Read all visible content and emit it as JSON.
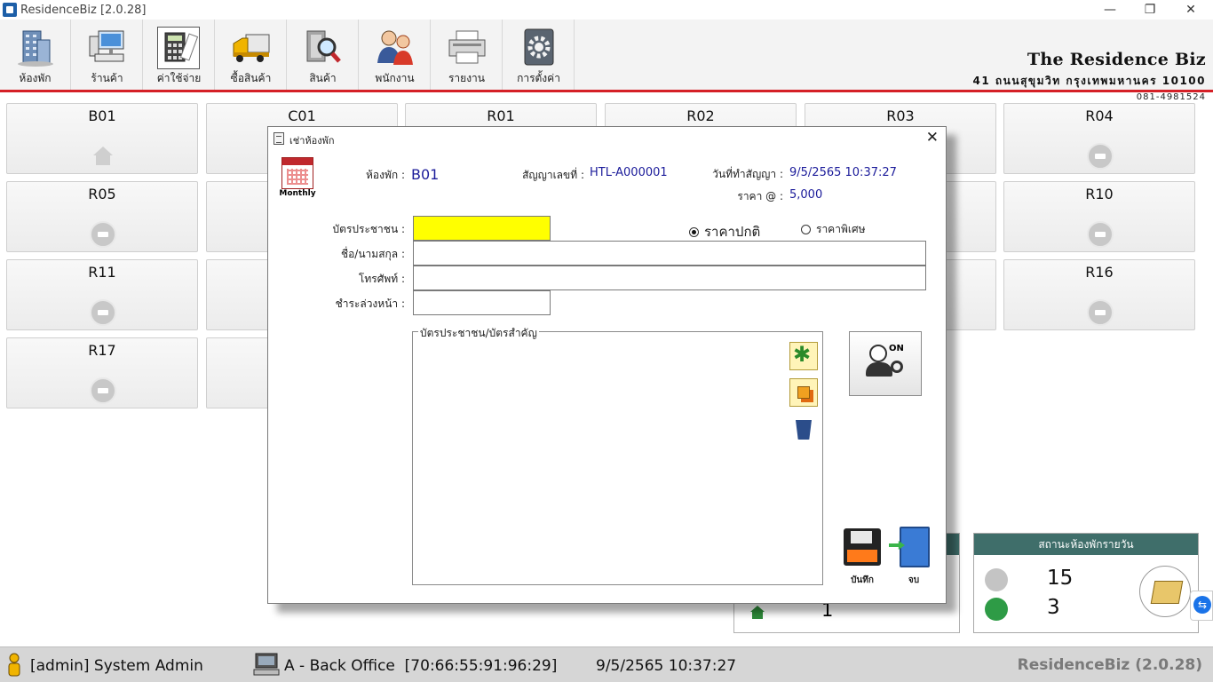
{
  "window": {
    "title": "ResidenceBiz [2.0.28]",
    "minimize": "—",
    "restore": "❐",
    "close": "✕"
  },
  "toolbar": {
    "items": [
      {
        "label": "ห้องพัก",
        "icon": "building-icon"
      },
      {
        "label": "ร้านค้า",
        "icon": "computer-icon"
      },
      {
        "label": "ค่าใช้จ่าย",
        "icon": "calculator-icon"
      },
      {
        "label": "ซื้อสินค้า",
        "icon": "truck-icon"
      },
      {
        "label": "สินค้า",
        "icon": "product-search-icon"
      },
      {
        "label": "พนักงาน",
        "icon": "staff-icon"
      },
      {
        "label": "รายงาน",
        "icon": "printer-icon"
      },
      {
        "label": "การตั้งค่า",
        "icon": "settings-gear-icon"
      }
    ]
  },
  "company": {
    "name": "The Residence Biz",
    "address": "41 ถนนสุขุมวิท กรุงเทพมหานคร 10100",
    "phone": "081-4981524"
  },
  "rooms": [
    {
      "name": "B01",
      "status": "home"
    },
    {
      "name": "C01",
      "status": "vacant"
    },
    {
      "name": "R01",
      "status": "vacant"
    },
    {
      "name": "R02",
      "status": "vacant"
    },
    {
      "name": "R03",
      "status": "vacant"
    },
    {
      "name": "R04",
      "status": "vacant"
    },
    {
      "name": "R05",
      "status": "vacant"
    },
    {
      "name": "R10",
      "status": "vacant"
    },
    {
      "name": "R11",
      "status": "vacant"
    },
    {
      "name": "R16",
      "status": "vacant"
    },
    {
      "name": "R17",
      "status": "vacant"
    }
  ],
  "daily_status": {
    "title": "สถานะห้องพักรายวัน",
    "vacant_count": "15",
    "occupied_count": "3",
    "other_count": "1"
  },
  "statusbar": {
    "user": "[admin] System Admin",
    "terminal": "A - Back Office  [70:66:55:91:96:29]",
    "datetime": "9/5/2565 10:37:27",
    "brand": "ResidenceBiz (2.0.28)"
  },
  "dialog": {
    "title": "เช่าห้องพัก",
    "close": "✕",
    "type_label": "Monthly",
    "room_label": "ห้องพัก :",
    "room_value": "B01",
    "contract_label": "สัญญาเลขที่ :",
    "contract_value": "HTL-A000001",
    "date_label": "วันที่ทำสัญญา :",
    "date_value": "9/5/2565 10:37:27",
    "price_label": "ราคา @ :",
    "price_value": "5,000",
    "id_card_label": "บัตรประชาชน :",
    "id_card_value": "",
    "name_label": "ชื่อ/นามสกุล :",
    "name_value": "",
    "phone_label": "โทรศัพท์ :",
    "phone_value": "",
    "deposit_label": "ชำระล่วงหน้า :",
    "deposit_value": "",
    "radio_normal": "ราคาปกติ",
    "radio_special": "ราคาพิเศษ",
    "documents_label": "บัตรประชาชน/บัตรสำคัญ",
    "on_label": "ON",
    "save_label": "บันทึก",
    "exit_label": "จบ"
  }
}
